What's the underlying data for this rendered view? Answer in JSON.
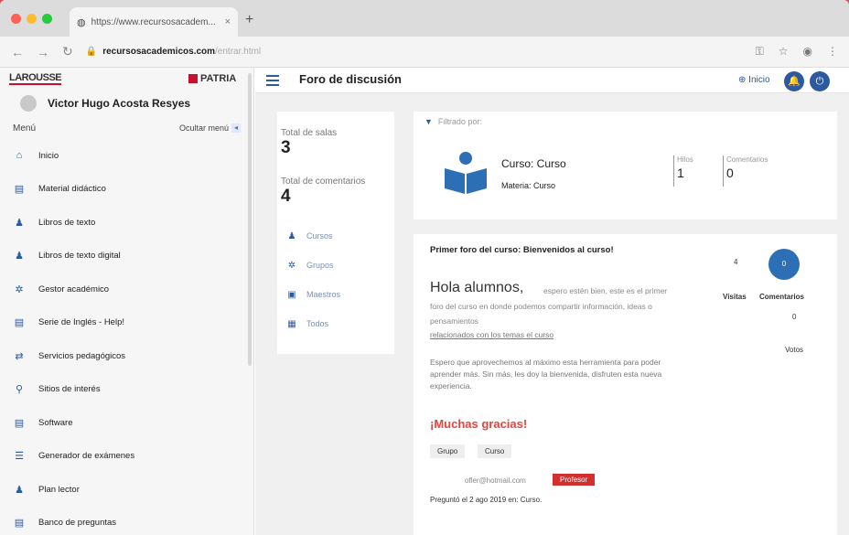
{
  "browser": {
    "tab_title": "https://www.recursosacadem...",
    "tab_close": "×",
    "new_tab": "+",
    "url_main": "recursosacademicos.com",
    "url_rest": "/entrar.html",
    "colors": {
      "red": "#fe5f57",
      "yellow": "#febc2e",
      "green": "#28c840"
    }
  },
  "sidebar": {
    "logo_left": "LAROUSSE",
    "logo_right": "PATRIA",
    "user_name": "Victor Hugo Acosta Resyes",
    "menu_label": "Menú",
    "hide_menu_label": "Ocultar menú",
    "items": [
      {
        "label": "Inicio",
        "icon": "home-icon"
      },
      {
        "label": "Material didáctico",
        "icon": "book-icon"
      },
      {
        "label": "Libros de texto",
        "icon": "users-icon"
      },
      {
        "label": "Libros de texto digital",
        "icon": "users-icon"
      },
      {
        "label": "Gestor académico",
        "icon": "group-icon"
      },
      {
        "label": "Serie de Inglés - Help!",
        "icon": "book-icon"
      },
      {
        "label": "Servicios pedagógicos",
        "icon": "exchange-icon"
      },
      {
        "label": "Sitios de interés",
        "icon": "link-icon"
      },
      {
        "label": "Software",
        "icon": "book-icon"
      },
      {
        "label": "Generador de exámenes",
        "icon": "list-icon"
      },
      {
        "label": "Plan lector",
        "icon": "users-icon"
      },
      {
        "label": "Banco de preguntas",
        "icon": "book-icon"
      }
    ]
  },
  "header": {
    "title": "Foro de discusión",
    "inicio_label": "Inicio",
    "accent": "#2c5aa0"
  },
  "stats": {
    "rooms_label": "Total de salas",
    "rooms_value": "3",
    "comments_label": "Total de comentarios",
    "comments_value": "4",
    "filters": [
      "Cursos",
      "Grupos",
      "Maestros",
      "Todos"
    ]
  },
  "course": {
    "filter_label": "Filtrado por:",
    "course": "Curso: Curso",
    "subject": "Materia: Curso",
    "threads_label": "Hilos",
    "threads_value": "1",
    "comments_label": "Comentarios",
    "comments_value": "0"
  },
  "post": {
    "title": "Primer foro del curso: Bienvenidos al curso!",
    "greeting": "Hola alumnos,",
    "body1": "espero estén bien, este es el primer foro del curso en donde podemos compartir información, ideas o pensamientos",
    "link": "relacionados con los temas el curso",
    "body2": "Espero que aprovechemos al máximo esta herramienta para poder aprender más. Sin más, les doy la bienvenida, disfruten esta nueva experiencia.",
    "thanks": "¡Muchas gracias!",
    "tags": [
      "Grupo",
      "Curso"
    ],
    "email": "ofler@hotmail.com",
    "role": "Profesor",
    "asked": "Preguntó el 2 ago 2019 en: Curso.",
    "views_value": "4",
    "views_label": "Visitas",
    "comments_value": "0",
    "comments_label": "Comentarios",
    "votes_value": "0",
    "votes_label": "Votos"
  }
}
